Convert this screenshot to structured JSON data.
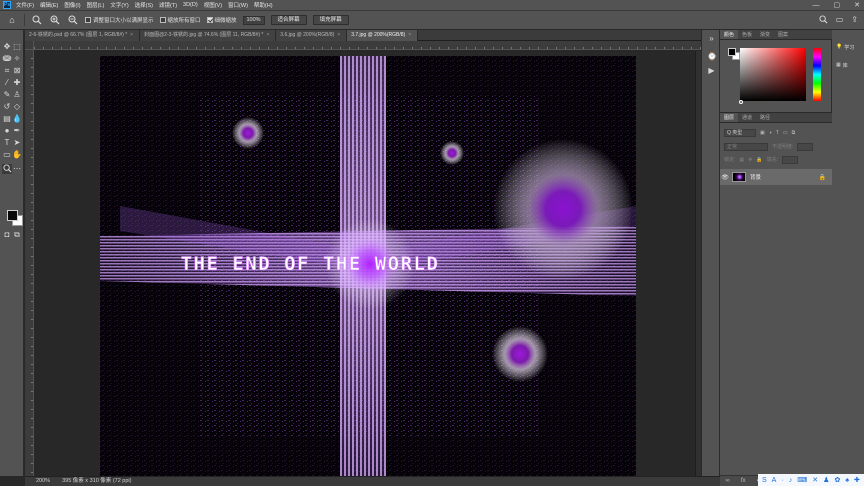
{
  "app": {
    "logo": "Ps"
  },
  "menu": [
    "文件(F)",
    "编辑(E)",
    "图像(I)",
    "图层(L)",
    "文字(Y)",
    "选择(S)",
    "滤镜(T)",
    "3D(D)",
    "视图(V)",
    "窗口(W)",
    "帮助(H)"
  ],
  "window_controls": {
    "minimize": "—",
    "maximize": "▢",
    "close": "✕"
  },
  "options": {
    "resize_windows": "调整窗口大小以满屏显示",
    "zoom_all": "缩放所有窗口",
    "scrubby_zoom": "细微缩放",
    "zoom_value": "100%",
    "fit_screen": "适合屏幕",
    "fill_screen": "填充屏幕"
  },
  "tabs": [
    {
      "label": "2-6-铁锈的.psd @ 66.7% (图层 1, RGB/8#) *",
      "active": false
    },
    {
      "label": "封面图@2-3-铁锈的.jpg @ 74.6% (图层 11, RGB/8#) *",
      "active": false
    },
    {
      "label": "3.6.jpg @ 200%(RGB/8)",
      "active": false
    },
    {
      "label": "3.7.jpg @ 200%(RGB/8)",
      "active": true
    }
  ],
  "tab_close": "×",
  "artwork": {
    "headline": "THE END OF THE WORLD",
    "accent": "#a020f0",
    "glow": "#d26bff"
  },
  "status": {
    "zoom": "200%",
    "doc_info": "395 像素 x 310 像素 (72 ppi)"
  },
  "color_panel": {
    "tabs": [
      "颜色",
      "色板",
      "渐变",
      "图案"
    ],
    "fg": "#000000",
    "bg": "#ffffff"
  },
  "layers_panel": {
    "tabs": [
      "图层",
      "通道",
      "路径"
    ],
    "search_placeholder": "Q 类型",
    "blend_mode": "正常",
    "opacity_label": "不透明度:",
    "lock_label": "锁定:",
    "fill_label": "填充:",
    "layer_name": "背景"
  },
  "learn_panel": {
    "items": [
      "学习",
      "库"
    ]
  },
  "tray_icons": [
    "S",
    "A",
    "·",
    "♪",
    "⌨",
    "✕",
    "♟",
    "✿",
    "♠",
    "✚"
  ]
}
